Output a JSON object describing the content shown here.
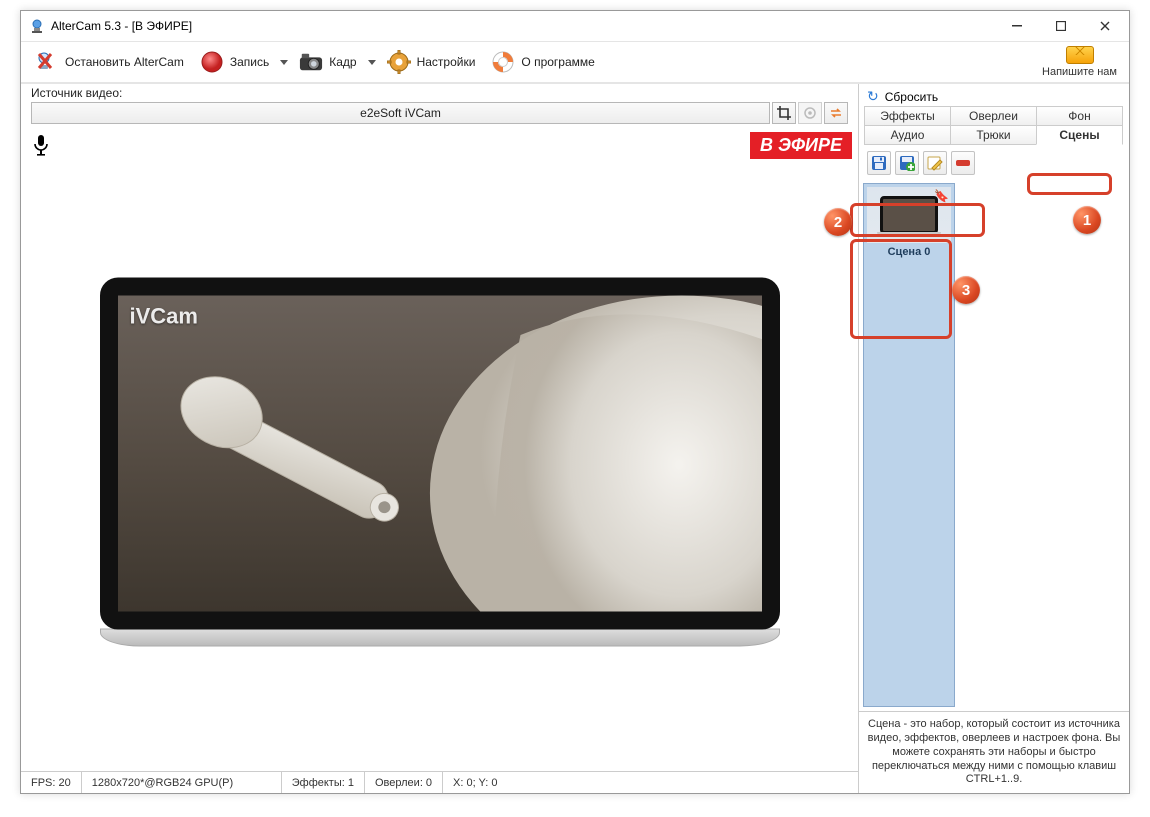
{
  "titlebar": {
    "title": "AlterCam 5.3 - [В ЭФИРЕ]"
  },
  "toolbar": {
    "stop_label": "Остановить AlterCam",
    "record_label": "Запись",
    "frame_label": "Кадр",
    "settings_label": "Настройки",
    "about_label": "О программе",
    "mail_label": "Напишите нам"
  },
  "source": {
    "label": "Источник видео:",
    "selected": "e2eSoft iVCam"
  },
  "preview": {
    "live_badge": "В ЭФИРЕ",
    "watermark": "iVCam"
  },
  "status": {
    "fps": "FPS: 20",
    "mode": "1280x720*@RGB24 GPU(P)",
    "effects": "Эффекты: 1",
    "overlays": "Оверлеи: 0",
    "xy": "X: 0; Y: 0"
  },
  "right": {
    "reset_label": "Сбросить",
    "tabs": [
      "Эффекты",
      "Оверлеи",
      "Фон",
      "Аудио",
      "Трюки",
      "Сцены"
    ],
    "active_tab_index": 5,
    "scene_name": "Сцена 0",
    "help_text": "Сцена - это набор, который состоит из источника видео, эффектов, оверлеев и настроек фона. Вы можете сохранять эти наборы и быстро переключаться между ними с помощью клавиш CTRL+1..9."
  },
  "icons": {
    "crop": "crop-icon",
    "gear": "gear-icon",
    "swap": "swap-icon",
    "save": "save-icon",
    "add": "add-icon",
    "edit": "edit-icon",
    "delete": "delete-icon"
  },
  "callout_labels": {
    "one": "1",
    "two": "2",
    "three": "3"
  }
}
